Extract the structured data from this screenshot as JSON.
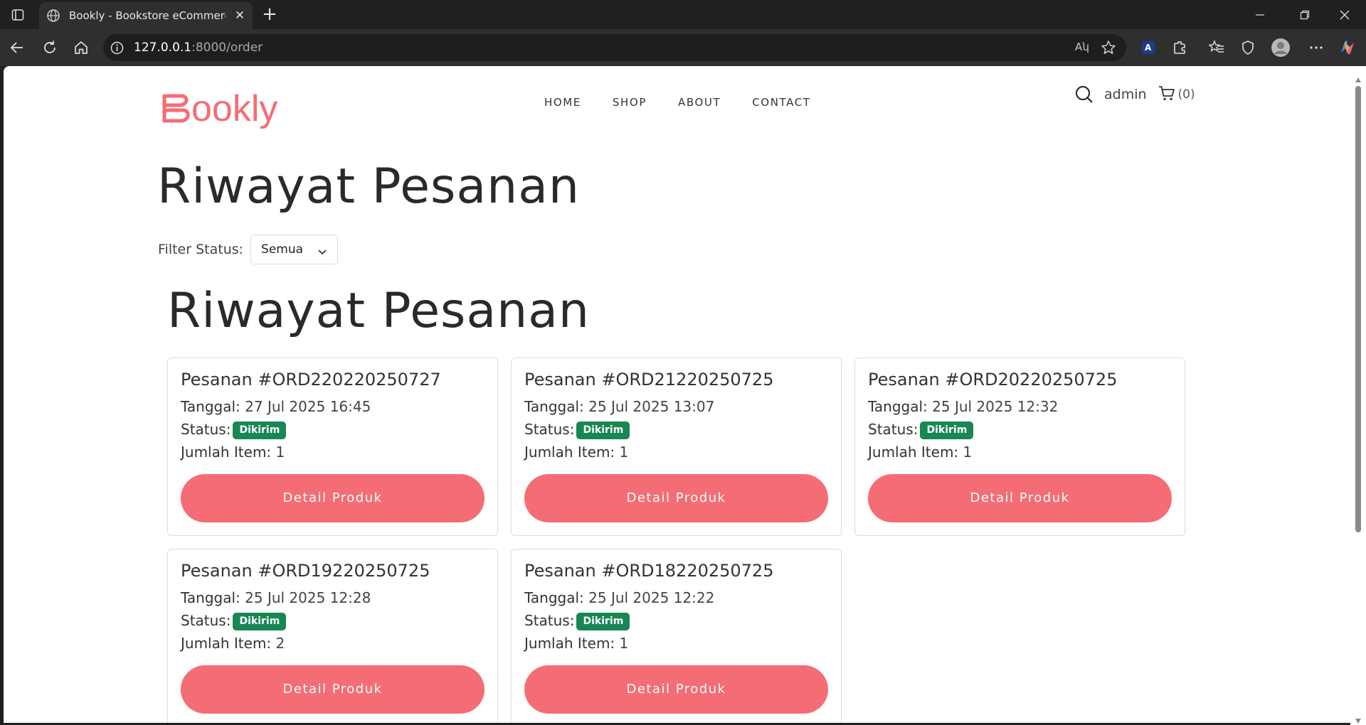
{
  "browser": {
    "tab_title": "Bookly - Bookstore eCommerce W",
    "url_host": "127.0.0.1",
    "url_path": ":8000/order",
    "new_tab_symbol": "+",
    "close_symbol": "✕",
    "read_aloud_glyph": "Aʮ"
  },
  "site": {
    "logo_text": "ookly",
    "nav": [
      "HOME",
      "SHOP",
      "ABOUT",
      "CONTACT"
    ],
    "user_name": "admin",
    "cart_count": "(0)",
    "brand_color": "#f46d75"
  },
  "page": {
    "title": "Riwayat Pesanan",
    "filter_label": "Filter Status:",
    "filter_value": "Semua",
    "section_title": "Riwayat Pesanan"
  },
  "labels": {
    "date": "Tanggal:",
    "status": "Status:",
    "items": "Jumlah Item:",
    "button": "Detail Produk"
  },
  "orders": [
    {
      "title": "Pesanan #ORD220220250727",
      "date": "27 Jul 2025 16:45",
      "status": "Dikirim",
      "items": "1"
    },
    {
      "title": "Pesanan #ORD21220250725",
      "date": "25 Jul 2025 13:07",
      "status": "Dikirim",
      "items": "1"
    },
    {
      "title": "Pesanan #ORD20220250725",
      "date": "25 Jul 2025 12:32",
      "status": "Dikirim",
      "items": "1"
    },
    {
      "title": "Pesanan #ORD19220250725",
      "date": "25 Jul 2025 12:28",
      "status": "Dikirim",
      "items": "2"
    },
    {
      "title": "Pesanan #ORD18220250725",
      "date": "25 Jul 2025 12:22",
      "status": "Dikirim",
      "items": "1"
    }
  ]
}
